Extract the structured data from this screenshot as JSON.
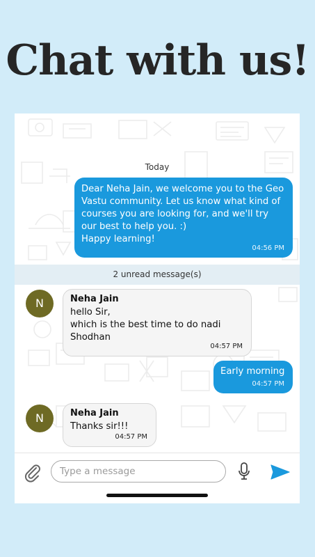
{
  "headline": "Chat with us!",
  "chat": {
    "date_label": "Today",
    "welcome": {
      "text": "Dear Neha Jain, we welcome you to the Geo Vastu community. Let us know what kind of courses you are looking for, and we'll try our best to help you. :)",
      "text2": "Happy learning!",
      "time": "04:56 PM"
    },
    "unread_banner": "2 unread message(s)",
    "msg1": {
      "avatar": "N",
      "sender": "Neha Jain",
      "line1": "hello Sir,",
      "line2": "which is the best time to do nadi Shodhan",
      "time": "04:57 PM"
    },
    "reply": {
      "text": "Early morning",
      "time": "04:57 PM"
    },
    "msg2": {
      "avatar": "N",
      "sender": "Neha Jain",
      "text": "Thanks sir!!!",
      "time": "04:57 PM"
    }
  },
  "composer": {
    "placeholder": "Type a message",
    "attach_icon": "paperclip-icon",
    "mic_icon": "microphone-icon",
    "send_icon": "send-icon"
  },
  "colors": {
    "background": "#d2ecf9",
    "outgoing_bubble": "#1a99dd",
    "incoming_bubble": "#f5f5f5",
    "avatar": "#6e6a24",
    "send": "#1a99dd"
  }
}
